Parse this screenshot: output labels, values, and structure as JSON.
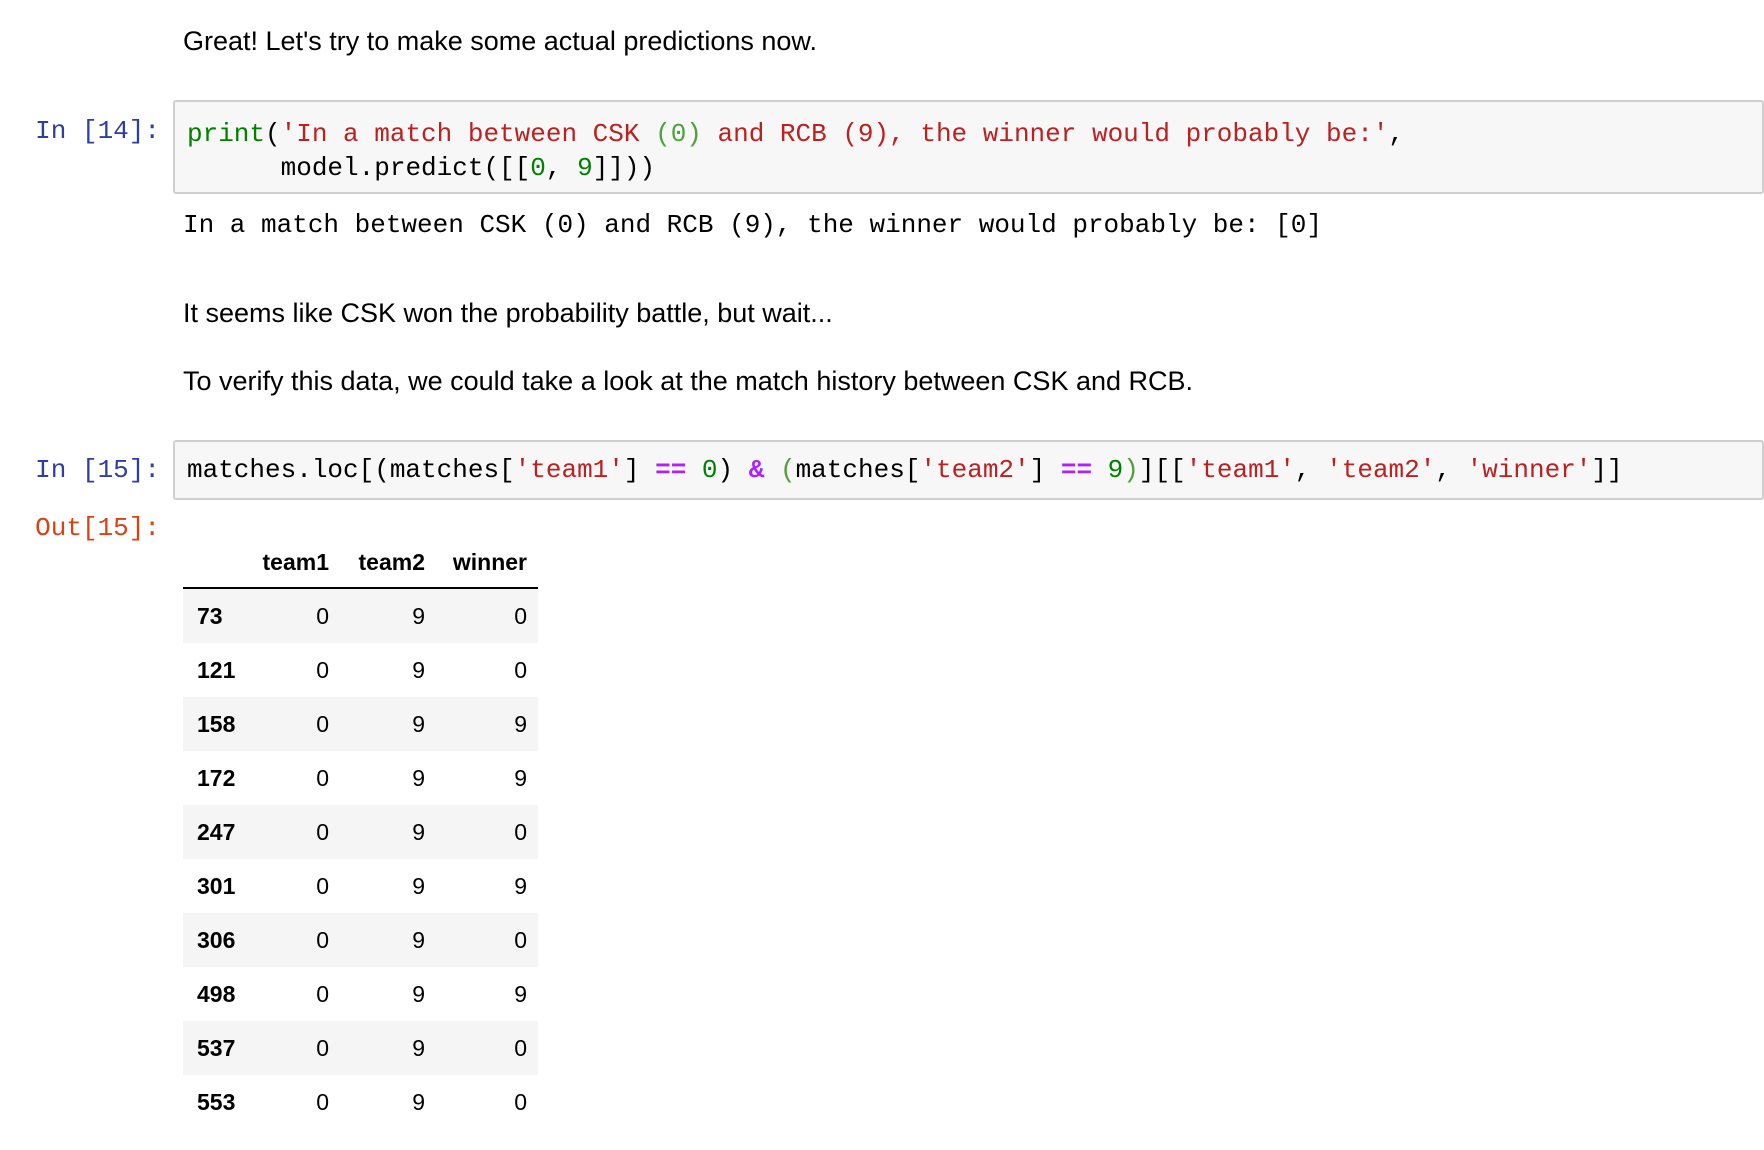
{
  "cells": {
    "md1": "Great! Let's try to make some actual predictions now.",
    "in14": {
      "prompt": "In [14]:",
      "line1": {
        "fn": "print",
        "open": "(",
        "str1": "'In a match between CSK ",
        "p1": "(0)",
        "str2": " and RCB (9), the winner would probably be:'",
        "comma": ","
      },
      "line2": {
        "indent": "      ",
        "pre": "model.predict([[",
        "n0": "0",
        "sep": ", ",
        "n9": "9",
        "post": "]]))"
      },
      "output": "In a match between CSK (0) and RCB (9), the winner would probably be: [0]"
    },
    "md2": "It seems like CSK won the probability battle, but wait...",
    "md3": "To verify this data, we could take a look at the match history between CSK and RCB.",
    "in15": {
      "prompt": "In [15]:",
      "t1": "matches.loc[(matches[",
      "s1": "'team1'",
      "t2": "] ",
      "op1": "==",
      "t3": " ",
      "n1": "0",
      "t4": ") ",
      "op2": "&",
      "t5": " ",
      "p1": "(",
      "t6": "matches[",
      "s2": "'team2'",
      "t7": "] ",
      "op3": "==",
      "t8": " ",
      "n2": "9",
      "p2": ")",
      "t9": "][[",
      "s3": "'team1'",
      "t10": ", ",
      "s4": "'team2'",
      "t11": ", ",
      "s5": "'winner'",
      "t12": "]]"
    },
    "out15": {
      "prompt": "Out[15]:",
      "columns": [
        "team1",
        "team2",
        "winner"
      ],
      "rows": [
        {
          "index": "73",
          "team1": "0",
          "team2": "9",
          "winner": "0"
        },
        {
          "index": "121",
          "team1": "0",
          "team2": "9",
          "winner": "0"
        },
        {
          "index": "158",
          "team1": "0",
          "team2": "9",
          "winner": "9"
        },
        {
          "index": "172",
          "team1": "0",
          "team2": "9",
          "winner": "9"
        },
        {
          "index": "247",
          "team1": "0",
          "team2": "9",
          "winner": "0"
        },
        {
          "index": "301",
          "team1": "0",
          "team2": "9",
          "winner": "9"
        },
        {
          "index": "306",
          "team1": "0",
          "team2": "9",
          "winner": "0"
        },
        {
          "index": "498",
          "team1": "0",
          "team2": "9",
          "winner": "9"
        },
        {
          "index": "537",
          "team1": "0",
          "team2": "9",
          "winner": "0"
        },
        {
          "index": "553",
          "team1": "0",
          "team2": "9",
          "winner": "0"
        }
      ]
    }
  }
}
